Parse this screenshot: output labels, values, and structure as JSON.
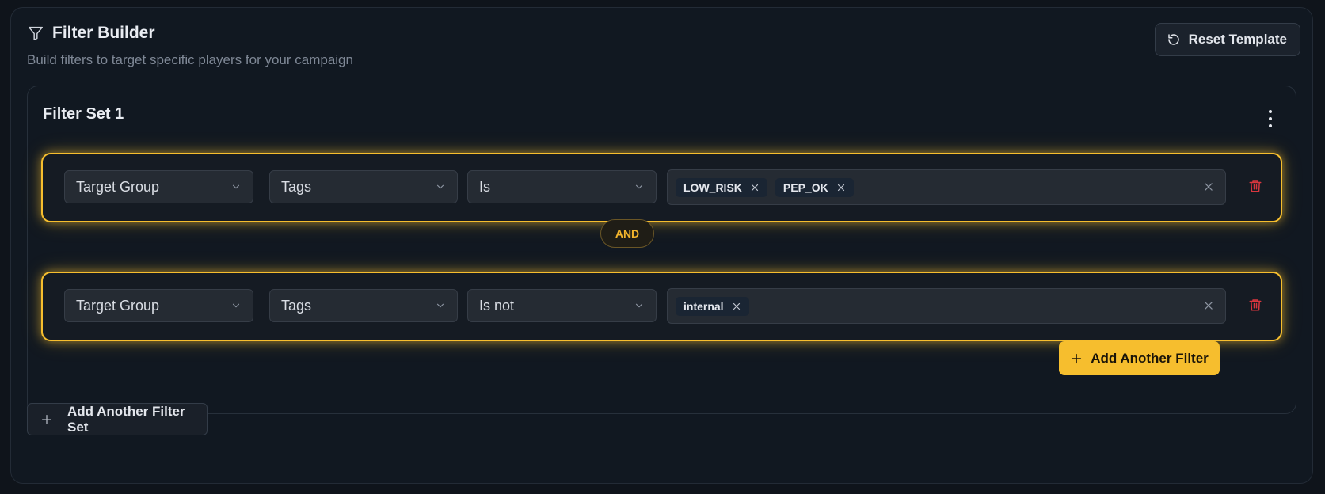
{
  "header": {
    "title": "Filter Builder",
    "subtitle": "Build filters to target specific players for your campaign",
    "reset_label": "Reset Template",
    "icon": "filter-funnel-icon"
  },
  "filter_set": {
    "title": "Filter Set 1",
    "menu_icon": "more-vertical-icon",
    "rows": [
      {
        "field": "Target Group",
        "attribute": "Tags",
        "operator": "Is",
        "values": [
          "LOW_RISK",
          "PEP_OK"
        ]
      },
      {
        "field": "Target Group",
        "attribute": "Tags",
        "operator": "Is not",
        "values": [
          "internal"
        ]
      }
    ],
    "connector": "AND",
    "add_filter_label": "Add Another Filter"
  },
  "add_set_label": "Add Another Filter Set",
  "colors": {
    "accent": "#f6be2e",
    "background": "#111821",
    "danger": "#d9363e"
  }
}
